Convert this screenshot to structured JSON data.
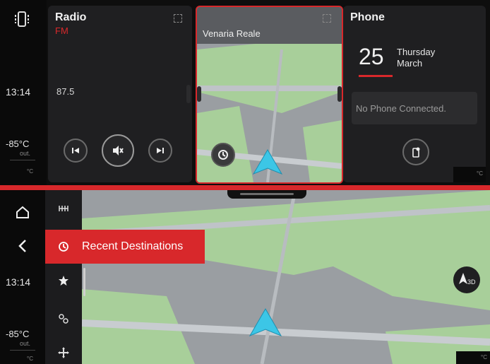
{
  "top": {
    "sidebar": {
      "time": "13:14",
      "temp": "-85°C",
      "temp_sub": "out.",
      "temp_unit": "°C",
      "app_icon": "phone-mirror-icon"
    },
    "radio": {
      "title": "Radio",
      "band": "FM",
      "frequency": "87.5",
      "controls": [
        "previous-icon",
        "mute-icon",
        "next-icon"
      ]
    },
    "nav": {
      "location": "Venaria Reale",
      "history_icon": "history-icon"
    },
    "phone": {
      "title": "Phone",
      "day": "25",
      "weekday": "Thursday",
      "month": "March",
      "status": "No Phone Connected.",
      "corner_unit": "°C"
    }
  },
  "bottom": {
    "sidebar": {
      "time": "13:14",
      "temp": "-85°C",
      "temp_sub": "out.",
      "temp_unit": "°C"
    },
    "menu": {
      "recent_label": "Recent Destinations",
      "icons": [
        "route-icon",
        "history-icon",
        "star-icon",
        "pin-route-icon",
        "move-icon"
      ]
    },
    "compass": "3D",
    "corner_unit": "°C"
  },
  "colors": {
    "accent": "#d8282b",
    "map_green": "#a8cf9a",
    "map_gray": "#9a9ea2",
    "arrow": "#3cc6e6"
  }
}
